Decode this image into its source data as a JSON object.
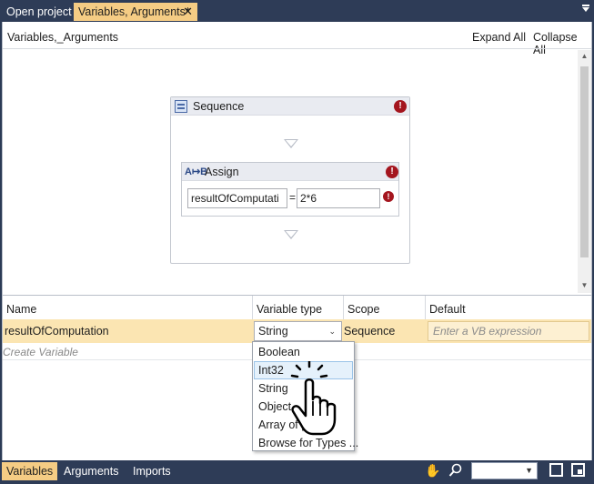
{
  "tabs": [
    {
      "label": "Open project"
    },
    {
      "label": "Variables, Arguments*",
      "close": "✕"
    }
  ],
  "designer": {
    "breadcrumb": "Variables,_Arguments",
    "expand_all": "Expand All",
    "collapse_all": "Collapse All",
    "sequence": {
      "title": "Sequence"
    },
    "assign": {
      "icon": "A↦B",
      "title": "Assign",
      "to_value": "resultOfComputati",
      "equals": "=",
      "value": "2*6"
    },
    "error_glyph": "!"
  },
  "variables": {
    "headers": {
      "name": "Name",
      "type": "Variable type",
      "scope": "Scope",
      "default": "Default"
    },
    "rows": [
      {
        "name": "resultOfComputation",
        "type": "String",
        "scope": "Sequence",
        "default_placeholder": "Enter a VB expression"
      }
    ],
    "create_variable": "Create Variable",
    "type_dropdown": {
      "options": [
        "Boolean",
        "Int32",
        "String",
        "Object",
        "Array of [T]",
        "Browse for Types ..."
      ],
      "highlighted": "Int32"
    }
  },
  "bottom_bar": {
    "tabs": [
      "Variables",
      "Arguments",
      "Imports"
    ],
    "active": "Variables"
  },
  "colors": {
    "accent": "#f5cc84",
    "frame": "#2e3c57",
    "error": "#a4151e",
    "row_highlight": "#fbe5b2"
  },
  "icons": [
    "sequence-icon",
    "assign-icon",
    "error-icon",
    "hand-cursor-icon",
    "pan-icon",
    "zoom-icon",
    "fit-screen-icon",
    "overview-icon"
  ]
}
